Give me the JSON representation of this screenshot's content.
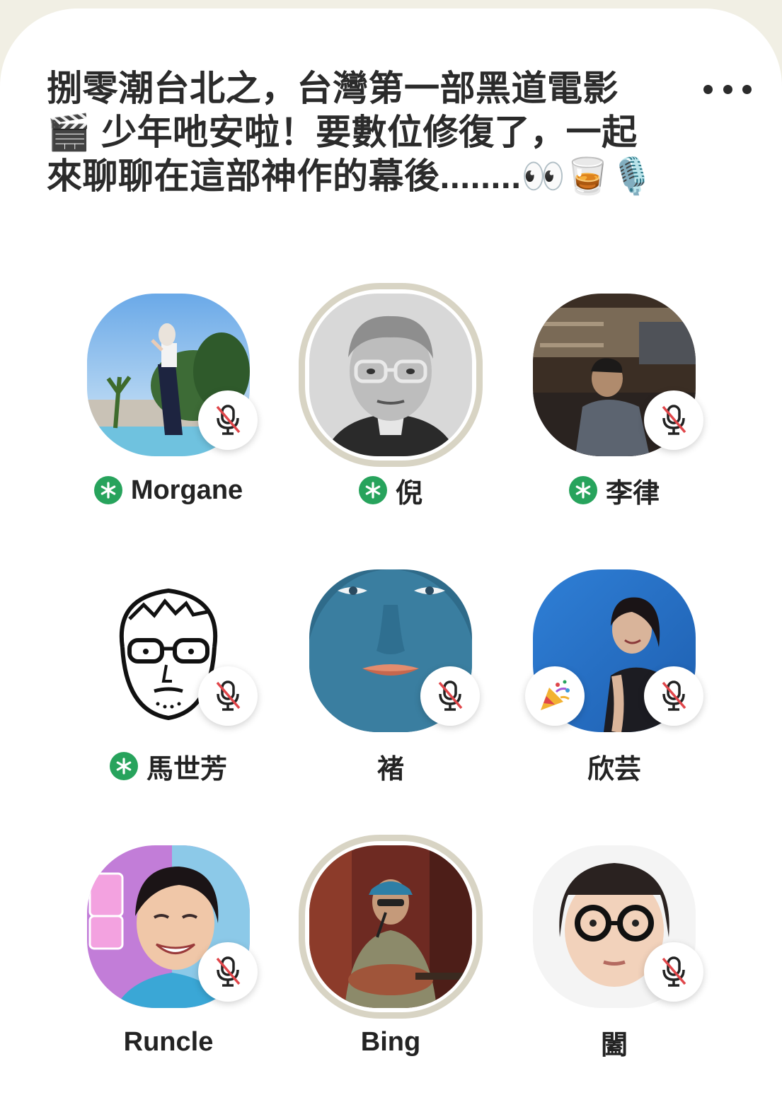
{
  "room": {
    "title": "捌零潮台北之，台灣第一部黑道電影🎬 少年吔安啦！要數位修復了，一起來聊聊在這部神作的幕後........👀🥃🎙️",
    "more_icon": "ellipsis-icon"
  },
  "colors": {
    "moderator_green": "#27a35c",
    "speaking_ring": "#d8d4c4",
    "mute_red": "#e0464a"
  },
  "speakers": [
    {
      "name": "Morgane",
      "moderator": true,
      "muted": true,
      "speaking": false
    },
    {
      "name": "倪",
      "moderator": true,
      "muted": false,
      "speaking": true
    },
    {
      "name": "李律",
      "moderator": true,
      "muted": true,
      "speaking": false
    },
    {
      "name": "馬世芳",
      "moderator": true,
      "muted": true,
      "speaking": false
    },
    {
      "name": "褚",
      "moderator": false,
      "muted": true,
      "speaking": false
    },
    {
      "name": "欣芸",
      "moderator": false,
      "muted": true,
      "speaking": false,
      "badge": "party-popper-icon"
    },
    {
      "name": "Runcle",
      "moderator": false,
      "muted": true,
      "speaking": false
    },
    {
      "name": "Bing",
      "moderator": false,
      "muted": false,
      "speaking": true
    },
    {
      "name": "闔",
      "moderator": false,
      "muted": true,
      "speaking": false
    }
  ]
}
